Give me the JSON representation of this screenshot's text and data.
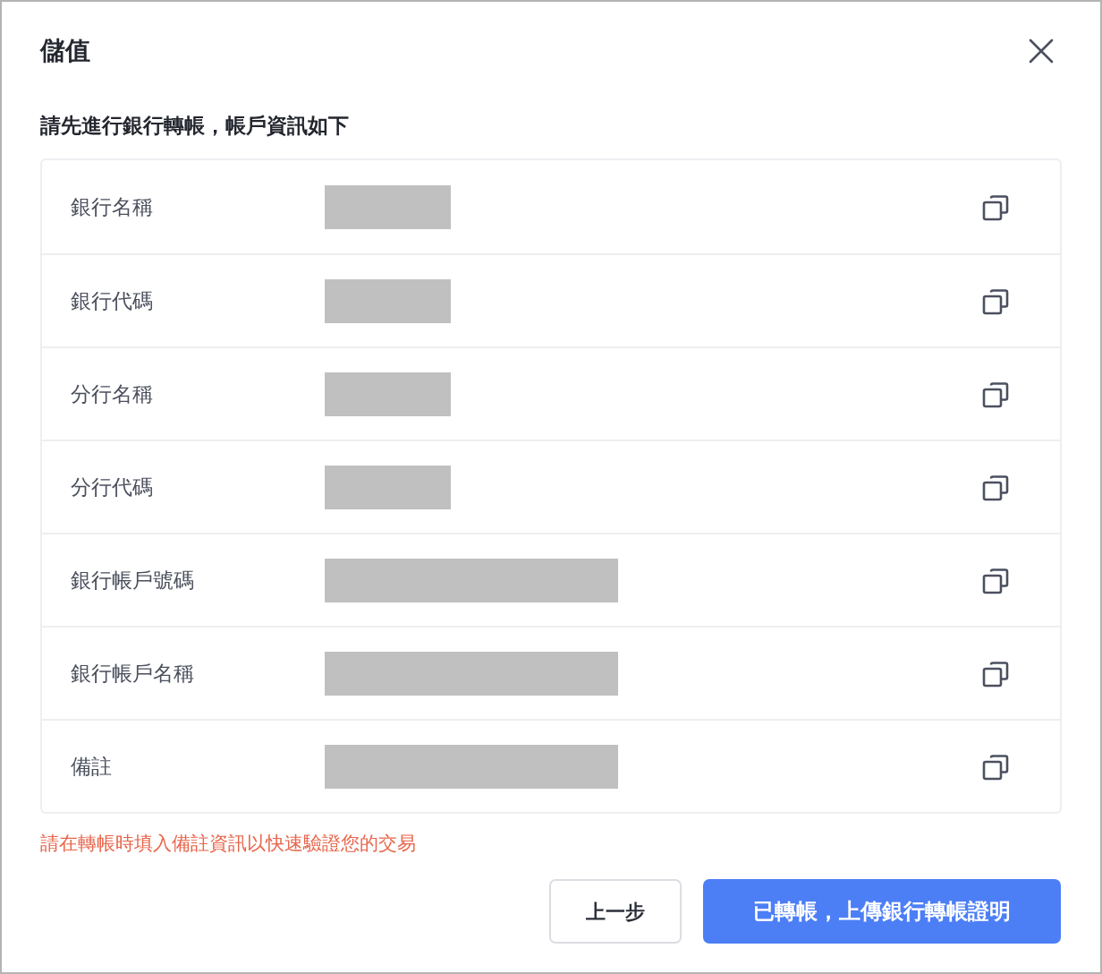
{
  "dialog": {
    "title": "儲值",
    "subtitle": "請先進行銀行轉帳，帳戶資訊如下"
  },
  "rows": [
    {
      "label": "銀行名稱",
      "kind": "short"
    },
    {
      "label": "銀行代碼",
      "kind": "short"
    },
    {
      "label": "分行名稱",
      "kind": "short"
    },
    {
      "label": "分行代碼",
      "kind": "short"
    },
    {
      "label": "銀行帳戶號碼",
      "kind": "long"
    },
    {
      "label": "銀行帳戶名稱",
      "kind": "long"
    },
    {
      "label": "備註",
      "kind": "long"
    }
  ],
  "note": "請在轉帳時填入備註資訊以快速驗證您的交易",
  "buttons": [
    {
      "label": "上一步",
      "kind": "secondary"
    },
    {
      "label": "已轉帳，上傳銀行轉帳證明",
      "kind": "primary"
    }
  ]
}
